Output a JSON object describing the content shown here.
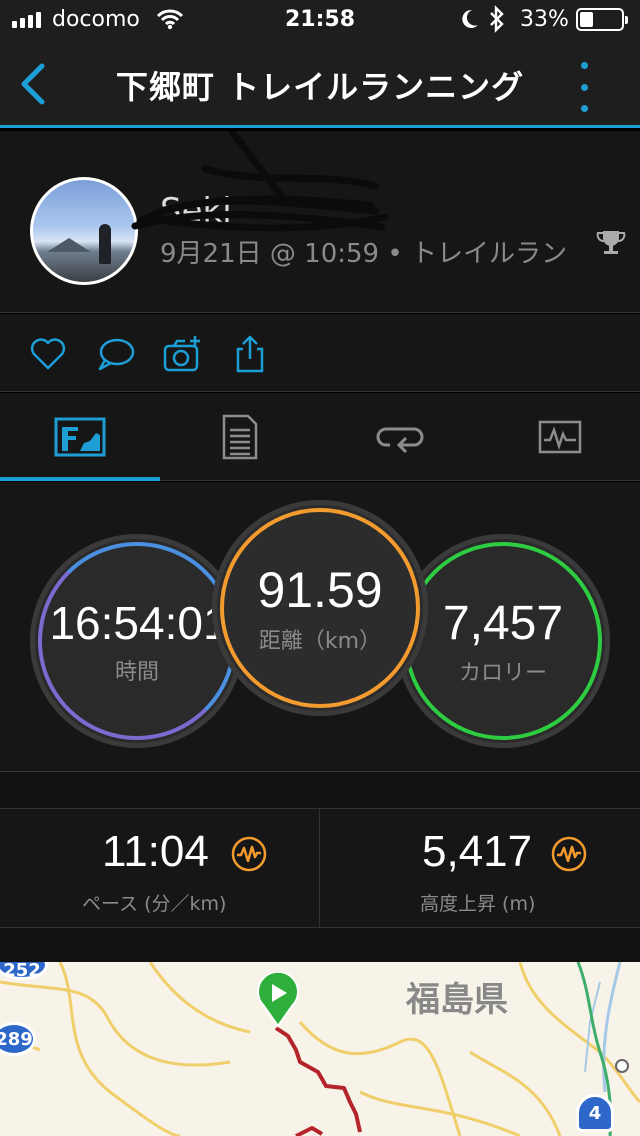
{
  "status_bar": {
    "carrier": "docomo",
    "time": "21:58",
    "battery_percent": "33%",
    "battery_level": 0.33
  },
  "header": {
    "title": "下郷町 トレイルランニング"
  },
  "profile": {
    "name": "Seki",
    "meta": "9月21日 @ 10:59 • トレイルラン"
  },
  "stats": {
    "time": {
      "value": "16:54:01",
      "label": "時間",
      "color": "#4a8fe0"
    },
    "distance": {
      "value": "91.59",
      "label": "距離（km）",
      "color": "#f39b2e"
    },
    "calories": {
      "value": "7,457",
      "label": "カロリー",
      "color": "#2ecc40"
    }
  },
  "metrics": {
    "pace": {
      "value": "11:04",
      "label": "ペース (分／km)"
    },
    "elevation": {
      "value": "5,417",
      "label": "高度上昇 (m)"
    }
  },
  "map": {
    "prefecture": "福島県",
    "route_289": "289",
    "route_4": "4",
    "route_top": "252"
  },
  "colors": {
    "accent": "#1d9fd6",
    "icon_orange": "#f39b2e",
    "route_red": "#b5242a"
  }
}
